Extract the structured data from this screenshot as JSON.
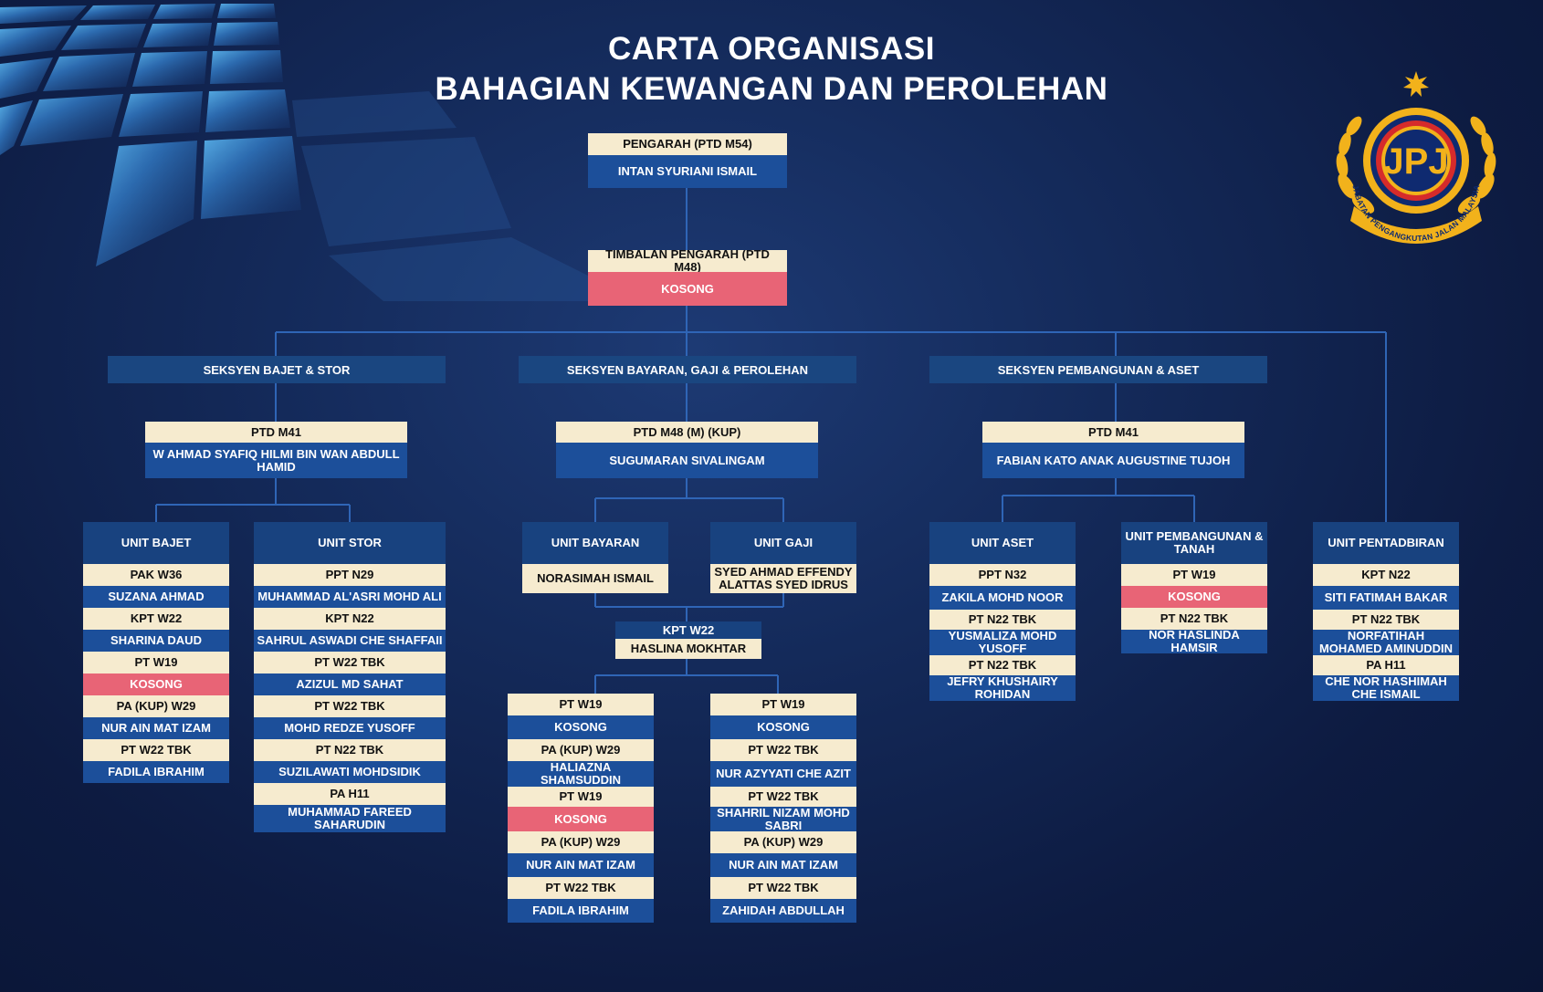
{
  "title": {
    "line1": "CARTA ORGANISASI",
    "line2": "BAHAGIAN KEWANGAN DAN PEROLEHAN"
  },
  "logo": {
    "text": "JPJ",
    "ring_text": "JABATAN PENGANGKUTAN JALAN MALAYSIA"
  },
  "colors": {
    "background": "#0d1b41",
    "cream": "#f6ebcf",
    "blue": "#1c4f9a",
    "pink": "#e86476",
    "gold": "#f2b21b",
    "line": "#2f65b6"
  },
  "pengarah": {
    "grade": "PENGARAH (PTD M54)",
    "name": "INTAN SYURIANI ISMAIL"
  },
  "timbalan": {
    "grade": "TIMBALAN PENGARAH (PTD M48)",
    "name": "KOSONG"
  },
  "sections": [
    {
      "label": "SEKSYEN BAJET & STOR",
      "head_grade": "PTD M41",
      "head_name": "W AHMAD SYAFIQ HILMI BIN WAN ABDULL HAMID"
    },
    {
      "label": "SEKSYEN BAYARAN, GAJI & PEROLEHAN",
      "head_grade": "PTD M48 (M) (KUP)",
      "head_name": "SUGUMARAN SIVALINGAM"
    },
    {
      "label": "SEKSYEN PEMBANGUNAN & ASET",
      "head_grade": "PTD M41",
      "head_name": "FABIAN KATO ANAK AUGUSTINE TUJOH"
    }
  ],
  "units": {
    "bajet": {
      "title": "UNIT BAJET",
      "rows": [
        "PAK W36",
        "SUZANA AHMAD",
        "KPT W22",
        "SHARINA DAUD",
        "PT W19",
        "KOSONG",
        "PA (KUP) W29",
        "NUR AIN MAT IZAM",
        "PT W22 TBK",
        "FADILA IBRAHIM"
      ]
    },
    "stor": {
      "title": "UNIT STOR",
      "rows": [
        "PPT N29",
        "MUHAMMAD AL'ASRI MOHD ALI",
        "KPT N22",
        "SAHRUL ASWADI CHE SHAFFAII",
        "PT W22 TBK",
        "AZIZUL MD SAHAT",
        "PT W22 TBK",
        "MOHD REDZE YUSOFF",
        "PT N22 TBK",
        "SUZILAWATI MOHDSIDIK",
        "PA  H11",
        "MUHAMMAD FAREED SAHARUDIN"
      ]
    },
    "bayaran": {
      "title": "UNIT BAYARAN",
      "rows": [
        "NORASIMAH ISMAIL"
      ]
    },
    "gaji": {
      "title": "UNIT GAJI",
      "rows": [
        "SYED AHMAD EFFENDY ALATTAS SYED IDRUS"
      ]
    },
    "kpt": {
      "rows": [
        "KPT W22",
        "HASLINA MOKHTAR"
      ]
    },
    "bayaran_staff": {
      "rows": [
        "PT W19",
        "KOSONG",
        "PA (KUP) W29",
        "HALIAZNA SHAMSUDDIN",
        "PT W19",
        "KOSONG",
        "PA (KUP) W29",
        "NUR AIN MAT IZAM",
        "PT W22 TBK",
        "FADILA IBRAHIM"
      ]
    },
    "gaji_staff": {
      "rows": [
        "PT W19",
        "KOSONG",
        "PT W22 TBK",
        "NUR AZYYATI CHE AZIT",
        "PT W22 TBK",
        "SHAHRIL NIZAM  MOHD SABRI",
        "PA (KUP) W29",
        "NUR AIN MAT IZAM",
        "PT W22 TBK",
        "ZAHIDAH ABDULLAH"
      ]
    },
    "aset": {
      "title": "UNIT ASET",
      "rows": [
        "PPT N32",
        "ZAKILA MOHD NOOR",
        "PT N22 TBK",
        "YUSMALIZA MOHD YUSOFF",
        "PT N22 TBK",
        "JEFRY KHUSHAIRY ROHIDAN"
      ]
    },
    "pembangunan": {
      "title": "UNIT PEMBANGUNAN & TANAH",
      "rows": [
        "PT W19",
        "KOSONG",
        "PT N22 TBK",
        "NOR HASLINDA HAMSIR"
      ]
    },
    "pentadbiran": {
      "title": "UNIT PENTADBIRAN",
      "rows": [
        "KPT N22",
        "SITI FATIMAH BAKAR",
        "PT N22 TBK",
        "NORFATIHAH MOHAMED AMINUDDIN",
        "PA H11",
        "CHE NOR HASHIMAH CHE ISMAIL"
      ]
    }
  }
}
